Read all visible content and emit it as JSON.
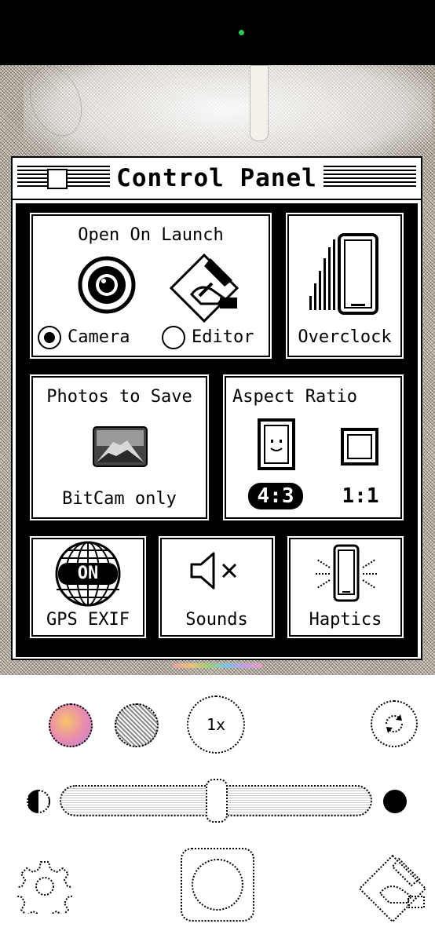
{
  "colors": {
    "frame": "#000000",
    "paper": "#ffffff",
    "camera_dot": "#34c759"
  },
  "window": {
    "title": "Control Panel"
  },
  "open_on_launch": {
    "title": "Open On Launch",
    "options": [
      {
        "label": "Camera",
        "selected": true,
        "icon": "camera-lens-icon"
      },
      {
        "label": "Editor",
        "selected": false,
        "icon": "paint-brush-icon"
      }
    ]
  },
  "overclock": {
    "label": "Overclock",
    "icon": "phone-speed-icon"
  },
  "photos_to_save": {
    "title": "Photos to Save",
    "value": "BitCam only",
    "icon": "mountain-photo-icon"
  },
  "aspect_ratio": {
    "title": "Aspect Ratio",
    "options": [
      {
        "label": "4:3",
        "selected": true,
        "icon": "portrait-frame-icon"
      },
      {
        "label": "1:1",
        "selected": false,
        "icon": "square-frame-icon"
      }
    ]
  },
  "gps_exif": {
    "label": "GPS EXIF",
    "state": "ON",
    "icon": "globe-icon"
  },
  "sounds": {
    "label": "Sounds",
    "state": "muted",
    "icon": "speaker-muted-icon"
  },
  "haptics": {
    "label": "Haptics",
    "icon": "phone-vibrate-icon"
  },
  "camera_controls": {
    "zoom_label": "1x",
    "buttons": [
      "palette-icon",
      "filter-icon",
      "zoom-icon",
      "switch-camera-icon"
    ],
    "brightness_slider": {
      "value": 0.5,
      "icons": [
        "half-circle-icon",
        "full-circle-icon"
      ]
    },
    "bottom": [
      "settings-gear-icon",
      "shutter-button",
      "editor-brush-icon"
    ]
  }
}
